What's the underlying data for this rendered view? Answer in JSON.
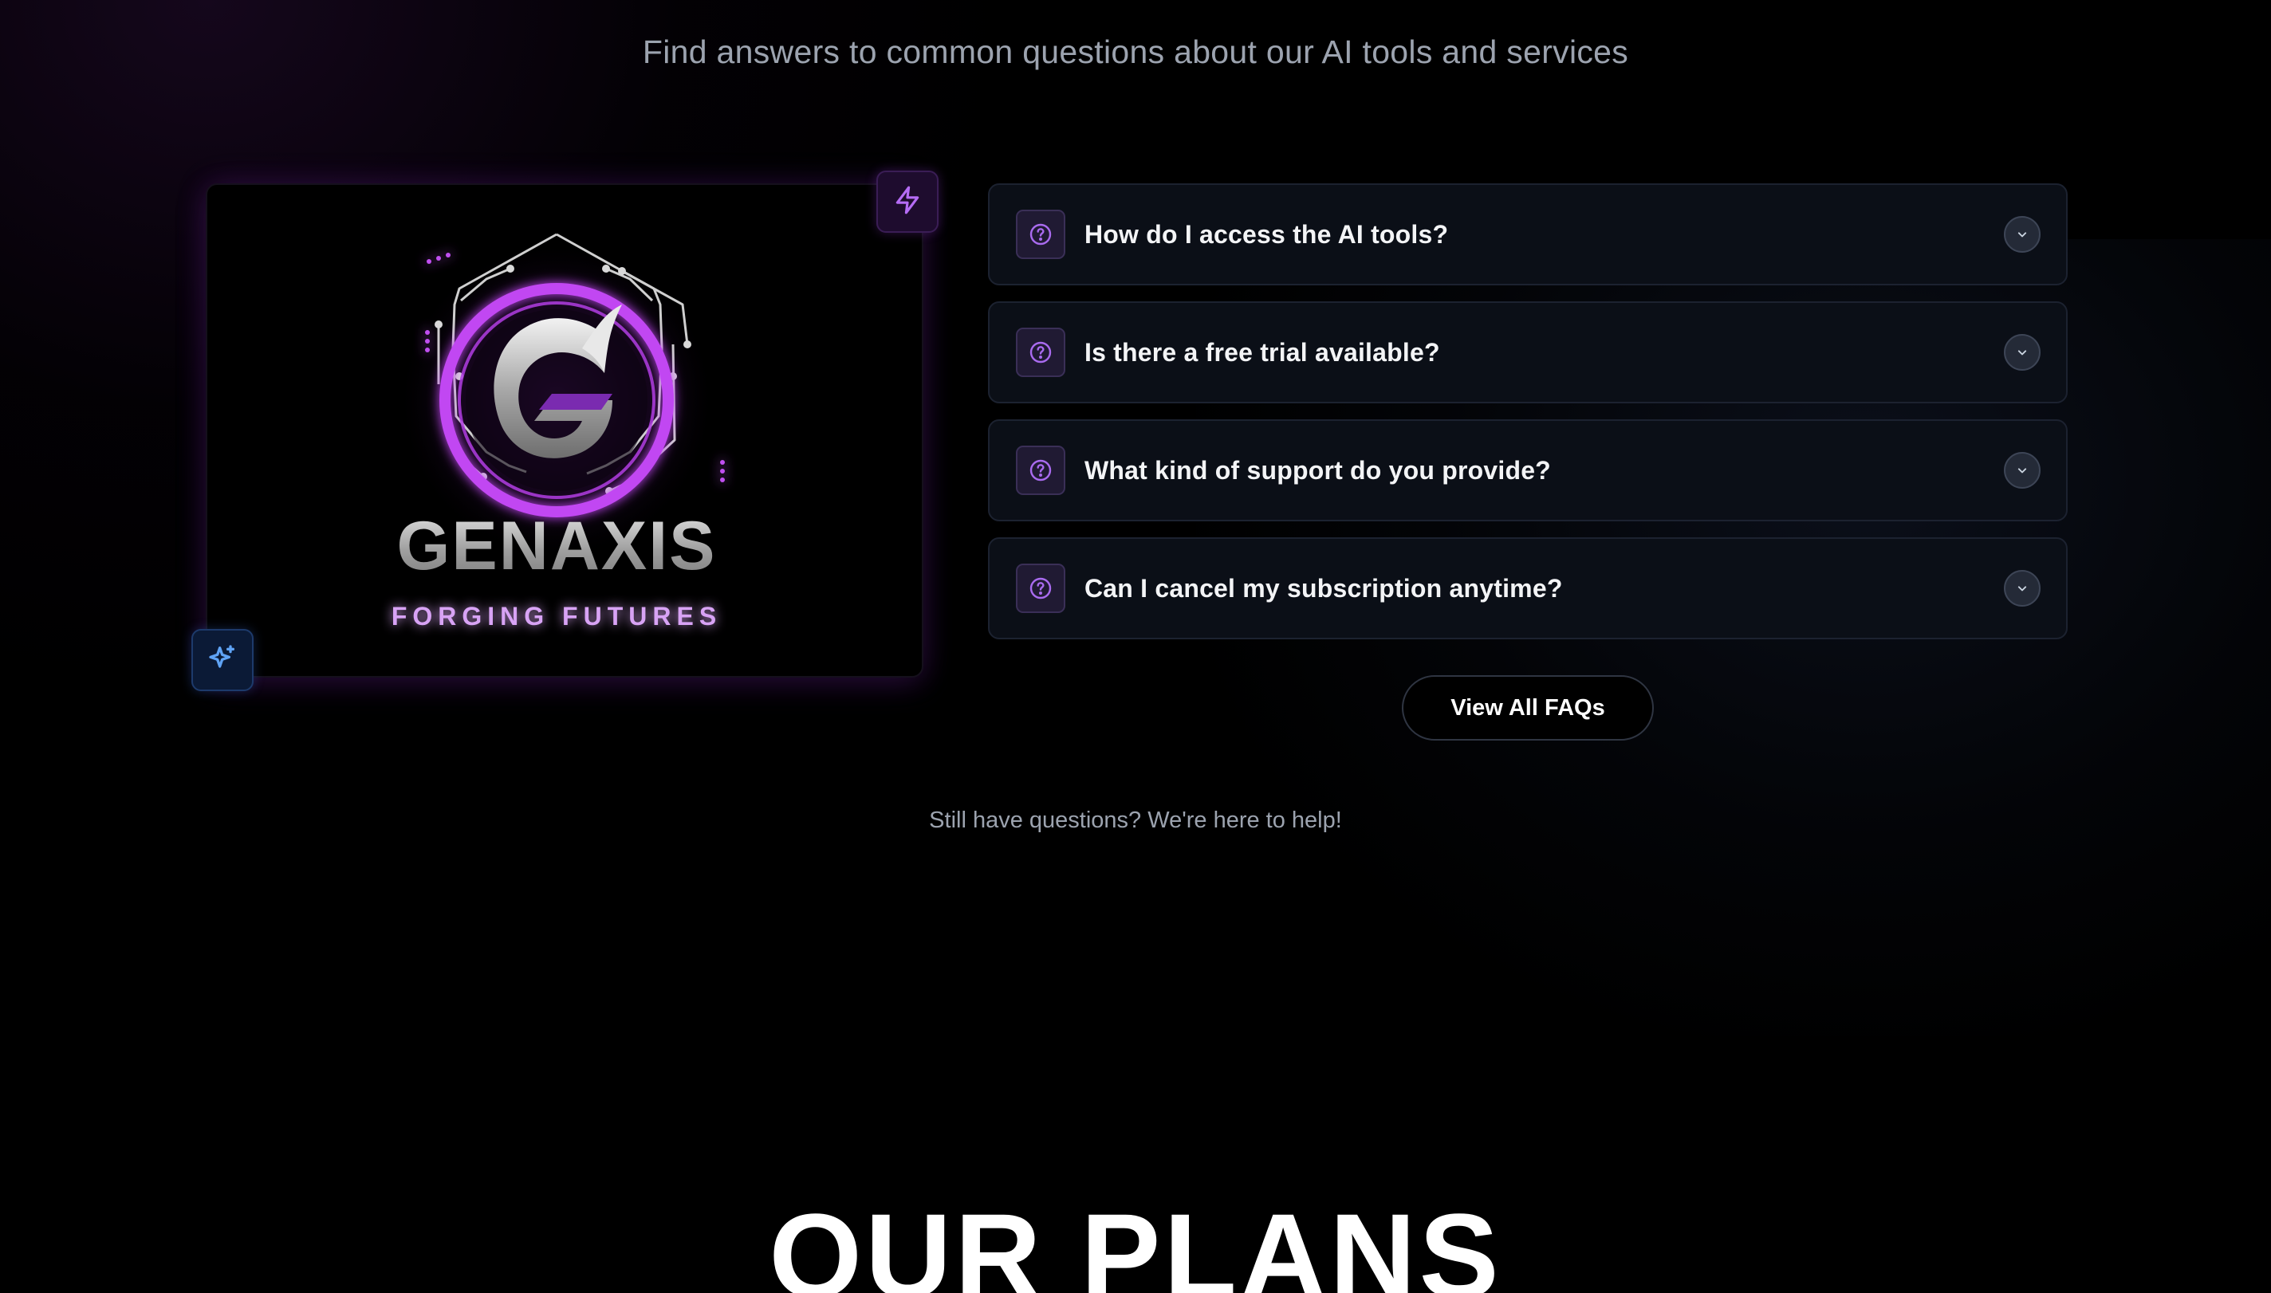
{
  "faq": {
    "subtitle": "Find answers to common questions about our AI tools and services",
    "items": [
      {
        "question": "How do I access the AI tools?"
      },
      {
        "question": "Is there a free trial available?"
      },
      {
        "question": "What kind of support do you provide?"
      },
      {
        "question": "Can I cancel my subscription anytime?"
      }
    ],
    "view_all_label": "View All FAQs",
    "help_text": "Still have questions? We're here to help!"
  },
  "logo": {
    "brand_name": "GENAXIS",
    "tagline": "FORGING FUTURES"
  },
  "icons": {
    "top_badge": "lightning-icon",
    "bottom_badge": "sparkle-icon",
    "question": "question-circle-icon",
    "expand": "chevron-down-icon"
  },
  "colors": {
    "accent_purple": "#a855f7",
    "accent_blue": "#60a5fa",
    "background": "#000000"
  },
  "plans": {
    "heading": "OUR PLANS"
  }
}
